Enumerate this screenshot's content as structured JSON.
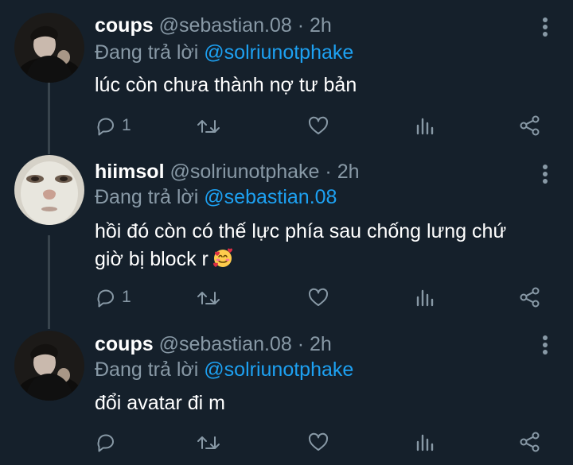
{
  "tweets": [
    {
      "display_name": "coups",
      "handle": "@sebastian.08",
      "time": "2h",
      "reply_prefix": "Đang trả lời",
      "reply_to": "@solriunotphake",
      "text": "lúc còn chưa thành nợ tư bản",
      "reply_count": "1",
      "avatar": "avatar-dark-photo"
    },
    {
      "display_name": "hiimsol",
      "handle": "@solriunotphake",
      "time": "2h",
      "reply_prefix": "Đang trả lời",
      "reply_to": "@sebastian.08",
      "text_line1": "hồi đó còn có thế lực phía sau chống lưng chứ",
      "text_line2": "giờ bị block r",
      "emoji": "smiling-face-with-hearts",
      "reply_count": "1",
      "avatar": "avatar-face-mask-photo"
    },
    {
      "display_name": "coups",
      "handle": "@sebastian.08",
      "time": "2h",
      "reply_prefix": "Đang trả lời",
      "reply_to": "@solriunotphake",
      "text": "đổi avatar đi m",
      "reply_count": "",
      "avatar": "avatar-dark-photo"
    }
  ],
  "separator": "·",
  "icons": [
    "reply-icon",
    "retweet-icon",
    "like-icon",
    "analytics-icon",
    "share-icon",
    "more-icon"
  ],
  "colors": {
    "background": "#15202b",
    "secondary_text": "#8899a6",
    "mention": "#1da1f2",
    "text": "#ffffff"
  }
}
